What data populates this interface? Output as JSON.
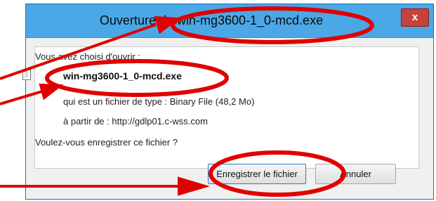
{
  "dialog": {
    "title": "Ouverture de win-mg3600-1_0-mcd.exe",
    "close_label": "x",
    "intro": "Vous avez choisi d'ouvrir :",
    "filename": "win-mg3600-1_0-mcd.exe",
    "type_line": "qui est un fichier de type : Binary File (48,2 Mo)",
    "source_line": "à partir de : http://gdlp01.c-wss.com",
    "question": "Voulez-vous enregistrer ce fichier ?",
    "save_label": "Enregistrer le fichier",
    "cancel_label": "Annuler"
  },
  "annotations": {
    "color": "#e00000",
    "items": [
      "title-ellipse",
      "filename-ellipse",
      "save-button-ellipse",
      "arrow-title",
      "arrow-filename",
      "arrow-save-button"
    ]
  }
}
